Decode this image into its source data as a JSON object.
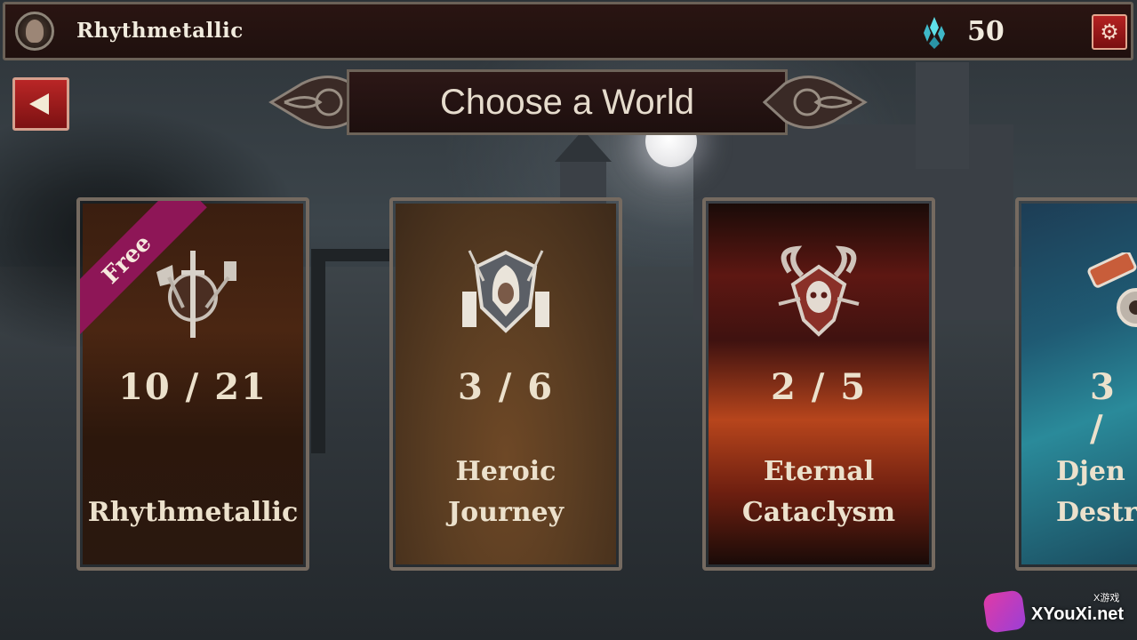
{
  "header": {
    "username": "Rhythmetallic",
    "gem_count": "50",
    "icons": {
      "avatar": "avatar-icon",
      "gem": "crystal-gem-icon",
      "settings": "gear-icon"
    }
  },
  "nav": {
    "back_icon": "back-arrow-icon"
  },
  "title": "Choose a World",
  "worlds": [
    {
      "name_line1": "Rhythmetallic",
      "name_line2": "",
      "progress": "10 / 21",
      "ribbon": "Free",
      "emblem": "axe-shield-hammer-emblem-icon"
    },
    {
      "name_line1": "Heroic",
      "name_line2": "Journey",
      "progress": "3 / 6",
      "emblem": "hooded-hero-shield-emblem-icon"
    },
    {
      "name_line1": "Eternal",
      "name_line2": "Cataclysm",
      "progress": "2 / 5",
      "emblem": "horned-skull-emblem-icon"
    },
    {
      "name_line1": "Djen",
      "name_line2": "Destru",
      "progress": "3 /",
      "emblem": "gear-emblem-icon"
    }
  ],
  "colors": {
    "accent_red": "#b52222",
    "ribbon_magenta": "#8e1657",
    "text_cream": "#ece1cc"
  },
  "watermark": {
    "text": "XYouXi.net",
    "small": "X游戏"
  }
}
